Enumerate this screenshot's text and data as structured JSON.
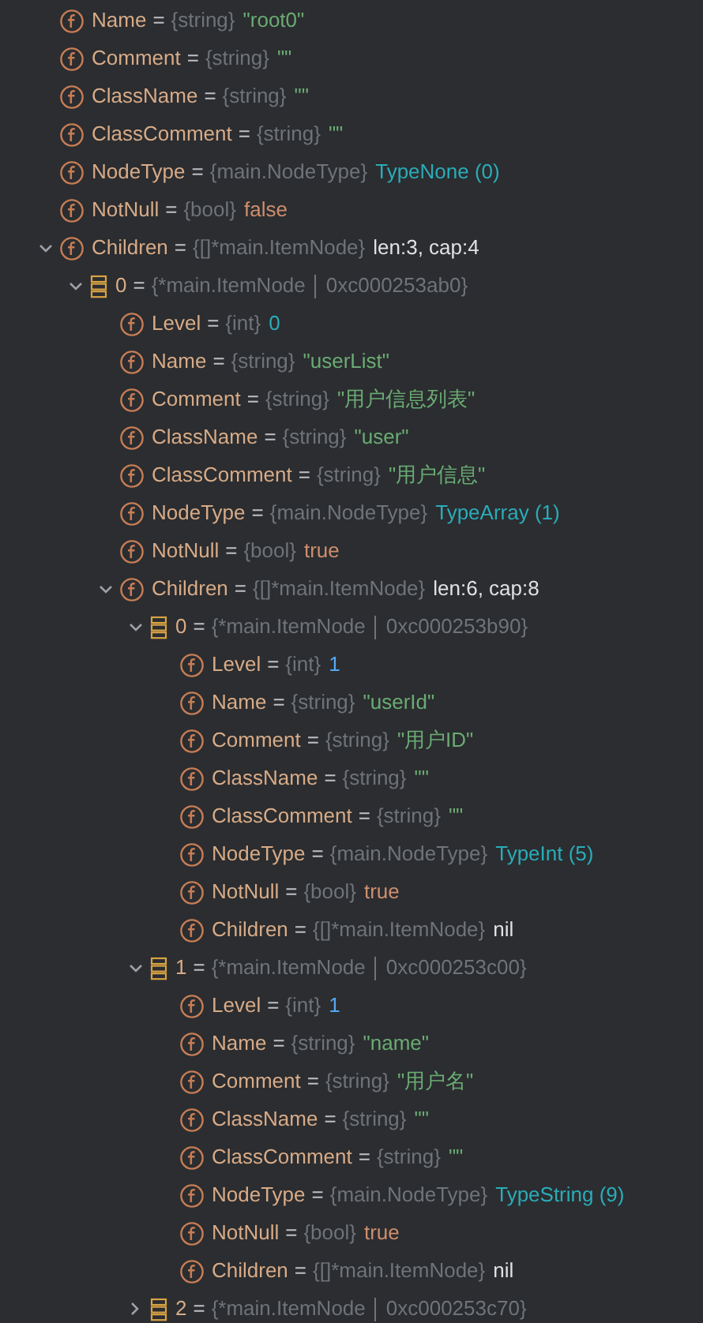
{
  "variables": [
    {
      "kind": "field",
      "name": "Name",
      "op": "=",
      "type": "{string}",
      "value": {
        "kind": "string",
        "text": "\"root0\""
      }
    },
    {
      "kind": "field",
      "name": "Comment",
      "op": "=",
      "type": "{string}",
      "value": {
        "kind": "string",
        "text": "\"\""
      }
    },
    {
      "kind": "field",
      "name": "ClassName",
      "op": "=",
      "type": "{string}",
      "value": {
        "kind": "string",
        "text": "\"\""
      }
    },
    {
      "kind": "field",
      "name": "ClassComment",
      "op": "=",
      "type": "{string}",
      "value": {
        "kind": "string",
        "text": "\"\""
      }
    },
    {
      "kind": "field",
      "name": "NodeType",
      "op": "=",
      "type": "{main.NodeType}",
      "value": {
        "kind": "enum",
        "text": "TypeNone (0)"
      }
    },
    {
      "kind": "field",
      "name": "NotNull",
      "op": "=",
      "type": "{bool}",
      "value": {
        "kind": "keyword",
        "text": "false"
      }
    },
    {
      "kind": "field",
      "name": "Children",
      "op": "=",
      "type": "{[]*main.ItemNode}",
      "value": {
        "kind": "plain",
        "text": "len:3, cap:4"
      },
      "expanded": true,
      "children": [
        {
          "kind": "element",
          "name": "0",
          "op": "=",
          "type": "{*main.ItemNode",
          "address": "0xc000253ab0}",
          "expanded": true,
          "children": [
            {
              "kind": "field",
              "name": "Level",
              "op": "=",
              "type": "{int}",
              "value": {
                "kind": "enum",
                "text": "0"
              }
            },
            {
              "kind": "field",
              "name": "Name",
              "op": "=",
              "type": "{string}",
              "value": {
                "kind": "string",
                "text": "\"userList\""
              }
            },
            {
              "kind": "field",
              "name": "Comment",
              "op": "=",
              "type": "{string}",
              "value": {
                "kind": "string",
                "text": "\"用户信息列表\""
              }
            },
            {
              "kind": "field",
              "name": "ClassName",
              "op": "=",
              "type": "{string}",
              "value": {
                "kind": "string",
                "text": "\"user\""
              }
            },
            {
              "kind": "field",
              "name": "ClassComment",
              "op": "=",
              "type": "{string}",
              "value": {
                "kind": "string",
                "text": "\"用户信息\""
              }
            },
            {
              "kind": "field",
              "name": "NodeType",
              "op": "=",
              "type": "{main.NodeType}",
              "value": {
                "kind": "enum",
                "text": "TypeArray (1)"
              }
            },
            {
              "kind": "field",
              "name": "NotNull",
              "op": "=",
              "type": "{bool}",
              "value": {
                "kind": "keyword",
                "text": "true"
              }
            },
            {
              "kind": "field",
              "name": "Children",
              "op": "=",
              "type": "{[]*main.ItemNode}",
              "value": {
                "kind": "plain",
                "text": "len:6, cap:8"
              },
              "expanded": true,
              "children": [
                {
                  "kind": "element",
                  "name": "0",
                  "op": "=",
                  "type": "{*main.ItemNode",
                  "address": "0xc000253b90}",
                  "expanded": true,
                  "children": [
                    {
                      "kind": "field",
                      "name": "Level",
                      "op": "=",
                      "type": "{int}",
                      "value": {
                        "kind": "number",
                        "text": "1"
                      }
                    },
                    {
                      "kind": "field",
                      "name": "Name",
                      "op": "=",
                      "type": "{string}",
                      "value": {
                        "kind": "string",
                        "text": "\"userId\""
                      }
                    },
                    {
                      "kind": "field",
                      "name": "Comment",
                      "op": "=",
                      "type": "{string}",
                      "value": {
                        "kind": "string",
                        "text": "\"用户ID\""
                      }
                    },
                    {
                      "kind": "field",
                      "name": "ClassName",
                      "op": "=",
                      "type": "{string}",
                      "value": {
                        "kind": "string",
                        "text": "\"\""
                      }
                    },
                    {
                      "kind": "field",
                      "name": "ClassComment",
                      "op": "=",
                      "type": "{string}",
                      "value": {
                        "kind": "string",
                        "text": "\"\""
                      }
                    },
                    {
                      "kind": "field",
                      "name": "NodeType",
                      "op": "=",
                      "type": "{main.NodeType}",
                      "value": {
                        "kind": "enum",
                        "text": "TypeInt (5)"
                      }
                    },
                    {
                      "kind": "field",
                      "name": "NotNull",
                      "op": "=",
                      "type": "{bool}",
                      "value": {
                        "kind": "keyword",
                        "text": "true"
                      }
                    },
                    {
                      "kind": "field",
                      "name": "Children",
                      "op": "=",
                      "type": "{[]*main.ItemNode}",
                      "value": {
                        "kind": "plain",
                        "text": "nil"
                      }
                    }
                  ]
                },
                {
                  "kind": "element",
                  "name": "1",
                  "op": "=",
                  "type": "{*main.ItemNode",
                  "address": "0xc000253c00}",
                  "expanded": true,
                  "children": [
                    {
                      "kind": "field",
                      "name": "Level",
                      "op": "=",
                      "type": "{int}",
                      "value": {
                        "kind": "number",
                        "text": "1"
                      }
                    },
                    {
                      "kind": "field",
                      "name": "Name",
                      "op": "=",
                      "type": "{string}",
                      "value": {
                        "kind": "string",
                        "text": "\"name\""
                      }
                    },
                    {
                      "kind": "field",
                      "name": "Comment",
                      "op": "=",
                      "type": "{string}",
                      "value": {
                        "kind": "string",
                        "text": "\"用户名\""
                      }
                    },
                    {
                      "kind": "field",
                      "name": "ClassName",
                      "op": "=",
                      "type": "{string}",
                      "value": {
                        "kind": "string",
                        "text": "\"\""
                      }
                    },
                    {
                      "kind": "field",
                      "name": "ClassComment",
                      "op": "=",
                      "type": "{string}",
                      "value": {
                        "kind": "string",
                        "text": "\"\""
                      }
                    },
                    {
                      "kind": "field",
                      "name": "NodeType",
                      "op": "=",
                      "type": "{main.NodeType}",
                      "value": {
                        "kind": "enum",
                        "text": "TypeString (9)"
                      }
                    },
                    {
                      "kind": "field",
                      "name": "NotNull",
                      "op": "=",
                      "type": "{bool}",
                      "value": {
                        "kind": "keyword",
                        "text": "true"
                      }
                    },
                    {
                      "kind": "field",
                      "name": "Children",
                      "op": "=",
                      "type": "{[]*main.ItemNode}",
                      "value": {
                        "kind": "plain",
                        "text": "nil"
                      }
                    }
                  ]
                },
                {
                  "kind": "element",
                  "name": "2",
                  "op": "=",
                  "type": "{*main.ItemNode",
                  "address": "0xc000253c70}",
                  "expanded": false
                }
              ]
            }
          ]
        }
      ]
    }
  ]
}
